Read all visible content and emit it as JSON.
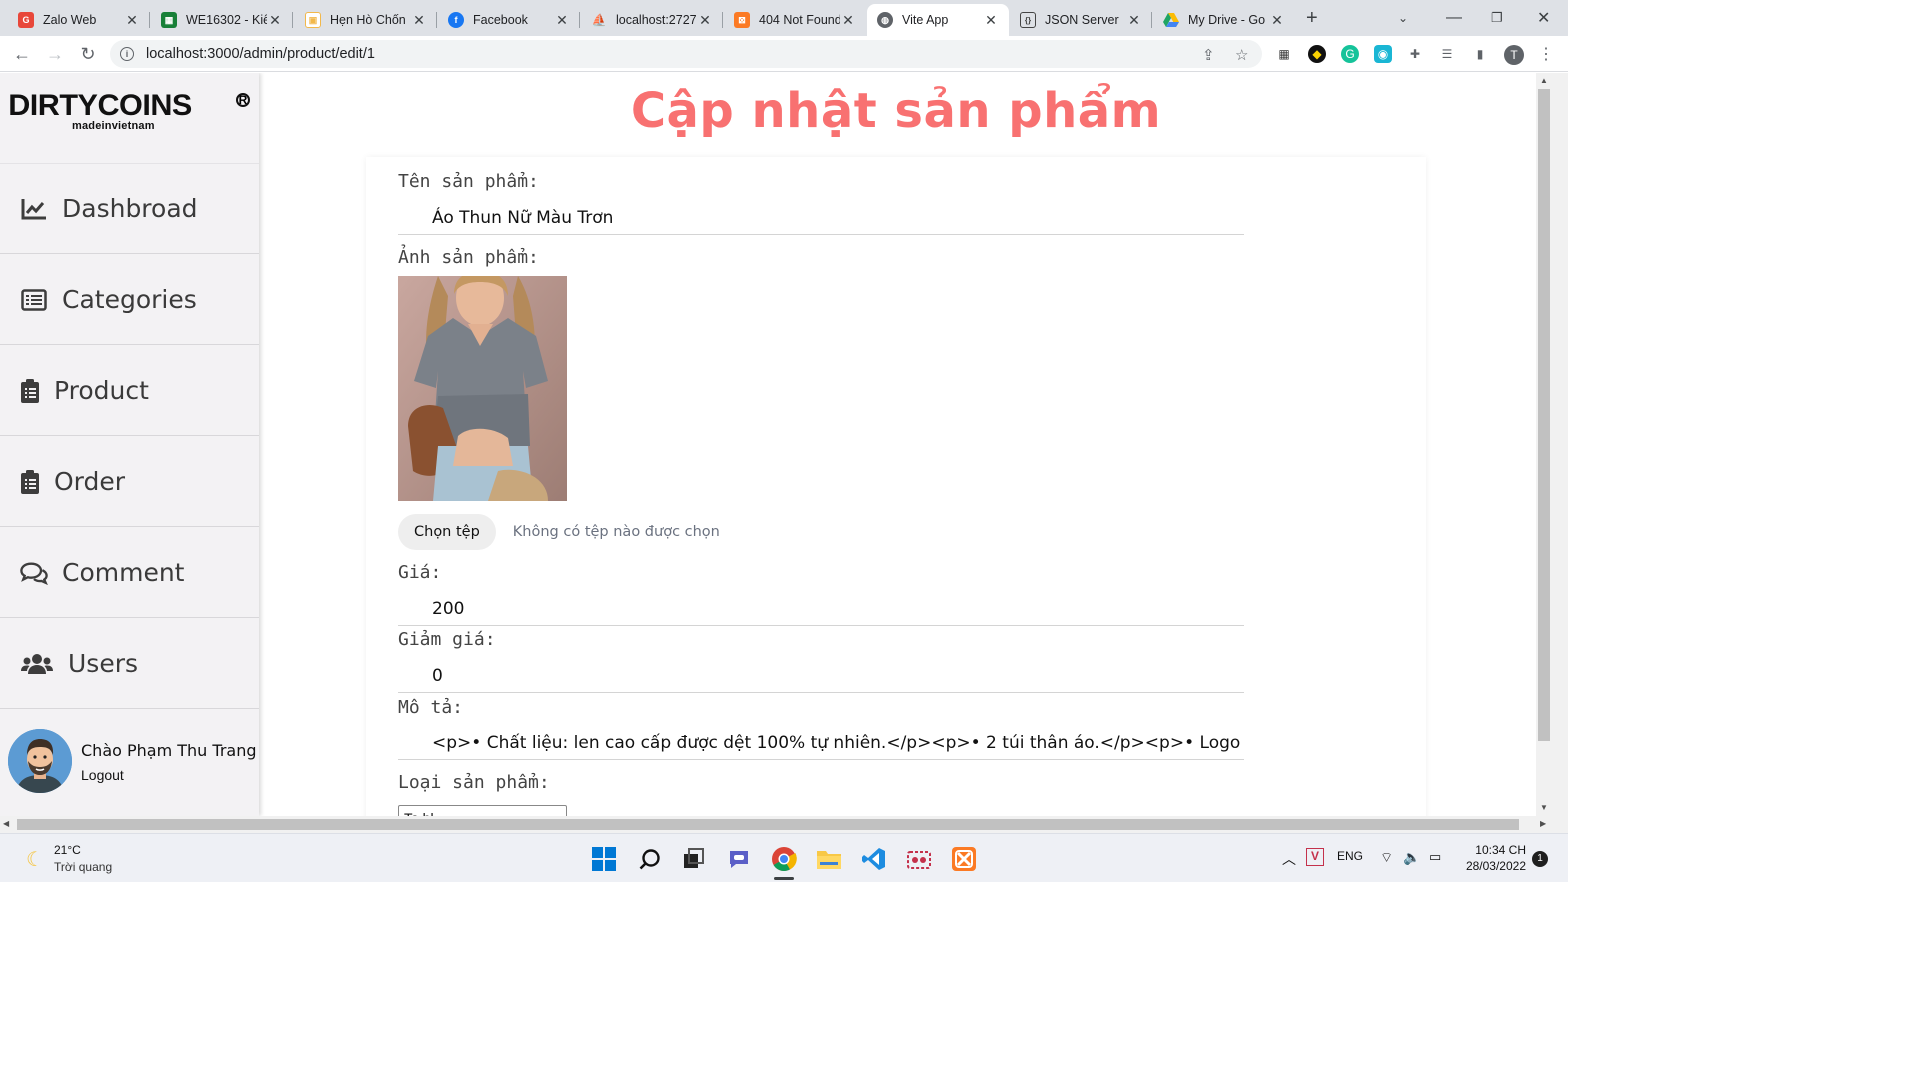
{
  "tabs": [
    {
      "title": "Zalo Web",
      "icon": "zalo-icon",
      "color": "#e8473a"
    },
    {
      "title": "WE16302 - Kiể",
      "icon": "sheets-icon",
      "color": "#188038"
    },
    {
      "title": "Hẹn Hò Chốn",
      "icon": "calendar-icon",
      "color": "#f2b84b"
    },
    {
      "title": "Facebook",
      "icon": "facebook-icon",
      "color": "#1877f2"
    },
    {
      "title": "localhost:2727",
      "icon": "phpmyadmin-icon",
      "color": "#f28c28"
    },
    {
      "title": "404 Not Found",
      "icon": "xampp-icon",
      "color": "#fb7a24"
    },
    {
      "title": "Vite App",
      "icon": "globe-icon",
      "color": "#5f6368"
    },
    {
      "title": "JSON Server",
      "icon": "json-server-icon",
      "color": "#444444"
    },
    {
      "title": "My Drive - Go",
      "icon": "drive-icon",
      "color": "#fbbc04"
    }
  ],
  "browser": {
    "url": "localhost:3000/admin/product/edit/1",
    "profile_initial": "T"
  },
  "sidebar": {
    "brand": "DIRTYCOINS",
    "brand_sub": "madeinvietnam",
    "items": [
      {
        "label": "Dashbroad",
        "icon": "chart-line-icon"
      },
      {
        "label": "Categories",
        "icon": "list-icon"
      },
      {
        "label": "Product",
        "icon": "clipboard-icon"
      },
      {
        "label": "Order",
        "icon": "clipboard-icon"
      },
      {
        "label": "Comment",
        "icon": "comments-icon"
      },
      {
        "label": "Users",
        "icon": "users-icon"
      }
    ],
    "greeting": "Chào Phạm Thu Trang",
    "logout": "Logout"
  },
  "page": {
    "title": "Cập nhật sản phẩm"
  },
  "form": {
    "name_label": "Tên sản phẩm:",
    "name_value": "Áo Thun Nữ Màu Trơn",
    "image_label": "Ảnh sản phẩm:",
    "file_button": "Chọn tệp",
    "file_status": "Không có tệp nào được chọn",
    "price_label": "Giá:",
    "price_value": "200",
    "discount_label": "Giảm giá:",
    "discount_value": "0",
    "desc_label": "Mô tả:",
    "desc_value": "<p>• Chất liệu: len cao cấp được dệt 100% tự nhiên.</p><p>• 2 túi thân áo.</p><p>• Logo Dico đ",
    "category_label": "Loại sản phẩm:",
    "category_value": "Ta bl..."
  },
  "taskbar": {
    "temp": "21°C",
    "weather": "Trời quang",
    "lang": "ENG",
    "time": "10:34 CH",
    "date": "28/03/2022",
    "notifications": "1"
  }
}
